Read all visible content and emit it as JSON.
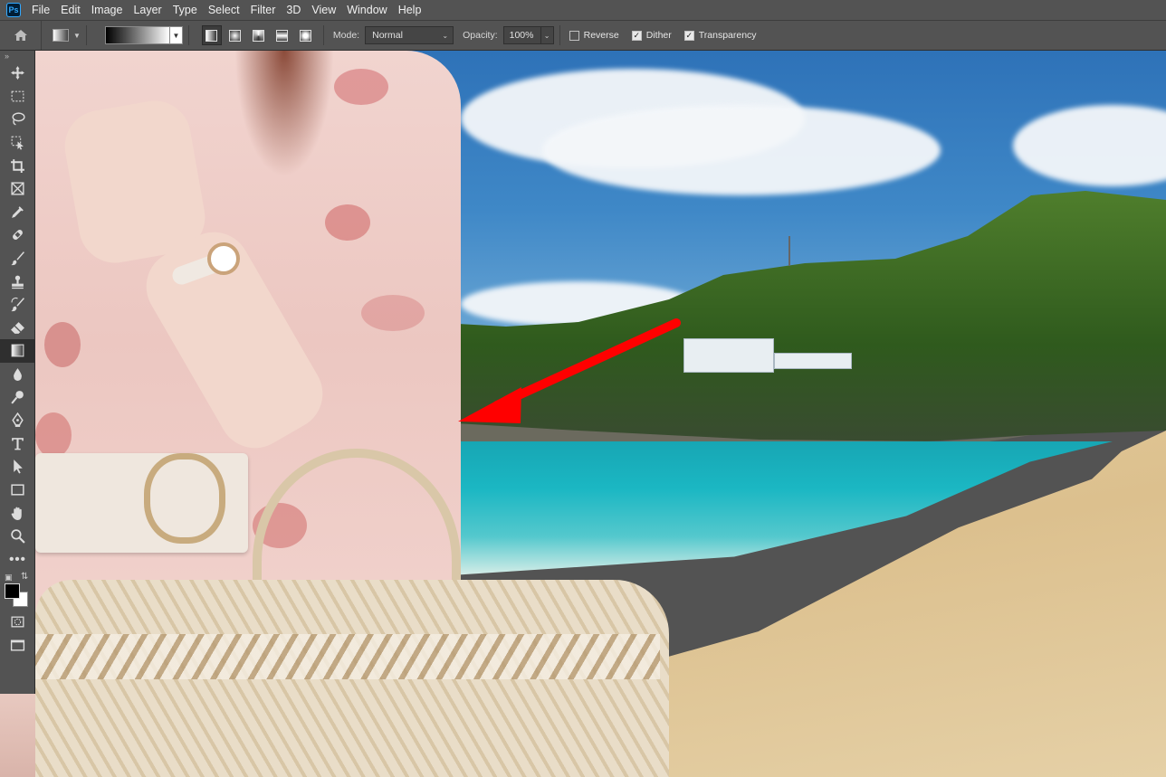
{
  "app": {
    "logo_text": "Ps"
  },
  "menu": [
    "File",
    "Edit",
    "Image",
    "Layer",
    "Type",
    "Select",
    "Filter",
    "3D",
    "View",
    "Window",
    "Help"
  ],
  "options": {
    "mode_label": "Mode:",
    "mode_value": "Normal",
    "opacity_label": "Opacity:",
    "opacity_value": "100%",
    "reverse_label": "Reverse",
    "reverse_checked": false,
    "dither_label": "Dither",
    "dither_checked": true,
    "transparency_label": "Transparency",
    "transparency_checked": true,
    "gradient_types": [
      "linear",
      "radial",
      "angle",
      "reflected",
      "diamond"
    ],
    "active_gradient_type": "linear"
  },
  "toolbar": {
    "tools": [
      "move-tool",
      "marquee-tool",
      "lasso-tool",
      "object-selection-tool",
      "crop-tool",
      "frame-tool",
      "eyedropper-tool",
      "healing-brush-tool",
      "brush-tool",
      "clone-stamp-tool",
      "history-brush-tool",
      "eraser-tool",
      "gradient-tool",
      "blur-tool",
      "dodge-tool",
      "pen-tool",
      "type-tool",
      "path-selection-tool",
      "rectangle-tool",
      "hand-tool",
      "zoom-tool",
      "edit-toolbar"
    ],
    "active_tool": "gradient-tool",
    "foreground_color": "#000000",
    "background_color": "#ffffff"
  },
  "colors": {
    "ui_background": "#535353",
    "arrow": "#ff0000"
  }
}
